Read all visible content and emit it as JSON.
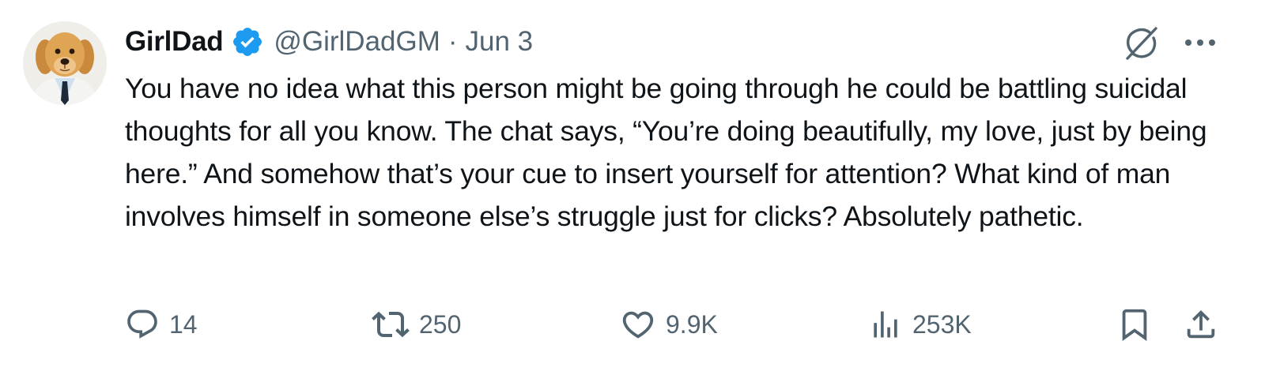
{
  "tweet": {
    "display_name": "GirlDad",
    "handle": "@GirlDadGM",
    "separator": "·",
    "date": "Jun 3",
    "text": "You have no idea what this person might be going through he could be battling suicidal thoughts for all you know. The chat says, “You’re doing beautifully, my love, just by being here.” And somehow that’s your cue to insert yourself for attention? What kind of man involves himself in someone else’s struggle just for clicks? Absolutely pathetic.",
    "metrics": {
      "replies": "14",
      "retweets": "250",
      "likes": "9.9K",
      "views": "253K"
    }
  },
  "colors": {
    "verified_blue": "#1d9bf0",
    "muted": "#536471",
    "text": "#0f1419"
  },
  "icons": {
    "avatar": "golden-retriever-avatar",
    "verified": "verified-badge-icon",
    "grok": "grok-icon",
    "more": "more-dots-icon",
    "reply": "reply-icon",
    "retweet": "retweet-icon",
    "like": "heart-icon",
    "views": "views-chart-icon",
    "bookmark": "bookmark-icon",
    "share": "share-icon"
  }
}
